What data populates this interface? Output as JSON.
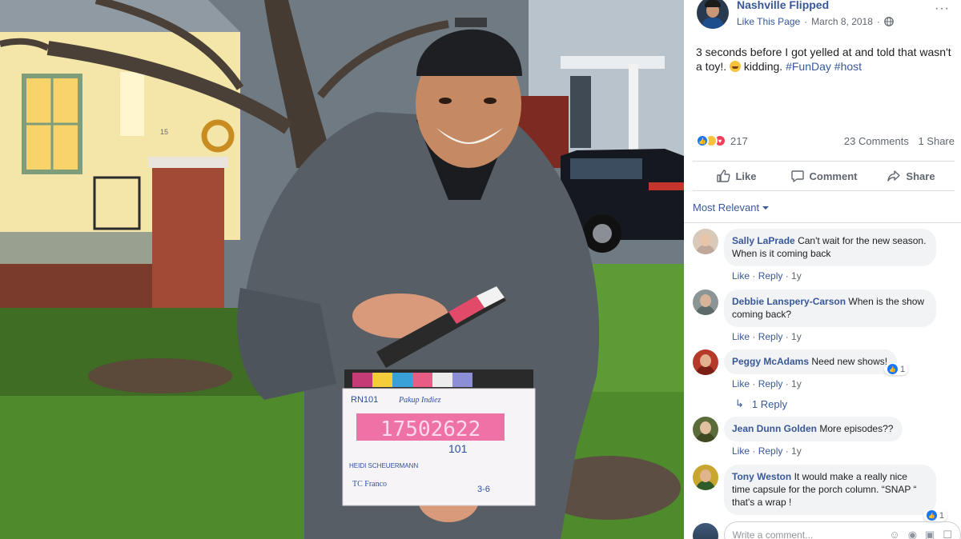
{
  "post": {
    "page_name": "Nashville Flipped",
    "like_page": "Like This Page",
    "date": "March 8, 2018",
    "separator": "·",
    "caption_text": "3 seconds before I got yelled at and told that wasn't a toy!.",
    "caption_after_emoji": "kidding.",
    "hashtags": [
      "#FunDay",
      "#host"
    ],
    "reaction_count": "217",
    "comments_count": "23 Comments",
    "shares_count": "1 Share"
  },
  "actions": {
    "like": "Like",
    "comment": "Comment",
    "share": "Share"
  },
  "sort_label": "Most Relevant",
  "comments": [
    {
      "author": "Sally LaPrade",
      "text": "Can't wait for the new season. When is it coming back",
      "like": "Like",
      "reply": "Reply",
      "time": "1y"
    },
    {
      "author": "Debbie Lanspery-Carson",
      "text": "When is the show coming back?",
      "like": "Like",
      "reply": "Reply",
      "time": "1y"
    },
    {
      "author": "Peggy McAdams",
      "text": "Need new shows!",
      "like": "Like",
      "reply": "Reply",
      "time": "1y",
      "reactions": "1"
    },
    {
      "author": "Jean Dunn Golden",
      "text": "More episodes??",
      "like": "Like",
      "reply": "Reply",
      "time": "1y"
    },
    {
      "author": "Tony Weston",
      "text": "It would make a really nice time capsule for the porch column. “SNAP “ that's a wrap !",
      "reactions": "1"
    }
  ],
  "replies_label": "1 Reply",
  "write_comment_placeholder": "Write a comment...",
  "clapper": {
    "roll": "RN101",
    "production": "Pakup Indiez",
    "timecode": "17502622",
    "scene": "101",
    "director": "HEIDI SCHEUERMANN",
    "camera": "TC Franco",
    "take": "3-6"
  },
  "house_number": "15",
  "icons": {
    "globe": "globe-icon",
    "like": "thumbs-up-icon",
    "comment": "speech-bubble-icon",
    "share": "share-arrow-icon",
    "reply": "reply-arrow-icon"
  },
  "colors": {
    "link": "#385898",
    "like_blue": "#1877f2",
    "haha_yellow": "#f7c33c",
    "love_red": "#f33e58"
  }
}
